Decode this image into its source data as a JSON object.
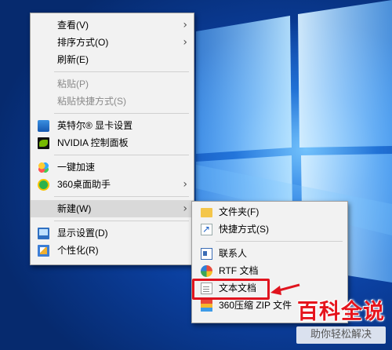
{
  "main_menu": {
    "items": [
      {
        "label": "查看(V)",
        "arrow": "›"
      },
      {
        "label": "排序方式(O)",
        "arrow": "›"
      },
      {
        "label": "刷新(E)"
      },
      {
        "label": "粘贴(P)"
      },
      {
        "label": "粘贴快捷方式(S)"
      },
      {
        "label": "英特尔® 显卡设置",
        "icon": "intel-graphics-icon"
      },
      {
        "label": "NVIDIA 控制面板",
        "icon": "nvidia-icon"
      },
      {
        "label": "一键加速",
        "icon": "boost-icon"
      },
      {
        "label": "360桌面助手",
        "icon": "360-desktop-icon",
        "arrow": "›"
      },
      {
        "label": "新建(W)",
        "arrow": "›"
      },
      {
        "label": "显示设置(D)",
        "icon": "display-settings-icon"
      },
      {
        "label": "个性化(R)",
        "icon": "personalize-icon"
      }
    ]
  },
  "sub_menu": {
    "items": [
      {
        "label": "文件夹(F)",
        "icon": "folder-icon"
      },
      {
        "label": "快捷方式(S)",
        "icon": "shortcut-icon"
      },
      {
        "label": "联系人",
        "icon": "contact-icon"
      },
      {
        "label": "RTF 文档",
        "icon": "rtf-document-icon"
      },
      {
        "label": "文本文档",
        "icon": "text-document-icon"
      },
      {
        "label": "360压缩 ZIP 文件",
        "icon": "zip-archive-icon"
      }
    ]
  },
  "watermark": {
    "title": "百科全说",
    "subtitle": "助你轻松解决"
  },
  "colors": {
    "menu_bg": "#f2f2f2",
    "hover_bg": "#d9d9d9",
    "highlight": "#e0141e",
    "watermark_red": "#e5141c"
  }
}
